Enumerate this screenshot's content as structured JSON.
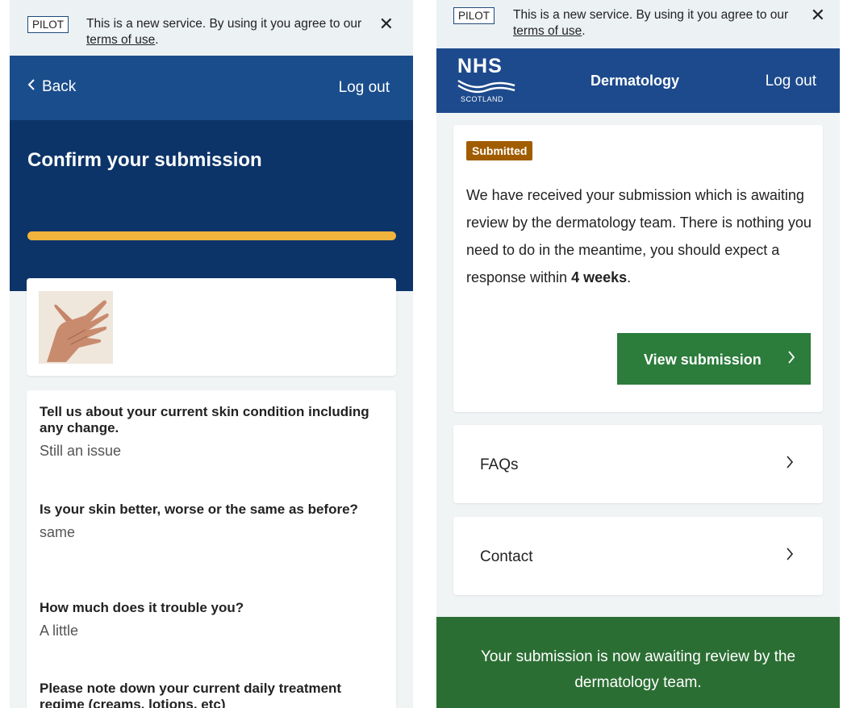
{
  "left_screen": {
    "pilot": {
      "tag": "PILOT",
      "text_before": "This is a new service. By using it you agree to our ",
      "terms_link": "terms of use",
      "text_after": ".",
      "close": "✕"
    },
    "nav": {
      "back": "Back",
      "logout": "Log out"
    },
    "title": "Confirm your submission",
    "progress": 1.0,
    "questions": [
      {
        "question": "Tell us about your current skin condition including any change.",
        "answer": "Still an issue"
      },
      {
        "question": "Is your skin better, worse or the same as before?",
        "answer": "same"
      },
      {
        "question": "How much does it trouble you?",
        "answer": "A little"
      },
      {
        "question": "Please note down your current daily treatment regime (creams, lotions, etc)",
        "answer": ""
      }
    ]
  },
  "right_screen": {
    "pilot": {
      "tag": "PILOT",
      "text_before": "This is a new service. By using it you agree to our ",
      "terms_link": "terms of use",
      "text_after": ".",
      "close": "✕"
    },
    "header": {
      "logo_word": "NHS",
      "logo_sub": "SCOTLAND",
      "service": "Dermatology",
      "logout": "Log out"
    },
    "status": {
      "badge": "Submitted",
      "text_before": "We have received your submission which is awaiting review by the dermatology team. There is nothing you need to do in the meantime, you should expect a response within ",
      "text_bold": "4 weeks",
      "text_after": ".",
      "button": "View submission"
    },
    "links": [
      {
        "label": "FAQs"
      },
      {
        "label": "Contact"
      }
    ],
    "footer": "Your submission is now awaiting review by the dermatology team."
  },
  "colors": {
    "nav_blue": "#1a4d8c",
    "hero_blue": "#0d3469",
    "progress_yellow": "#f0b43c",
    "badge_brown": "#a15c00",
    "button_green": "#2c7c3c",
    "footer_green": "#2b6e33"
  },
  "icons": {
    "back": "chevron-left-icon",
    "chevron": "chevron-right-icon",
    "close": "close-icon"
  }
}
